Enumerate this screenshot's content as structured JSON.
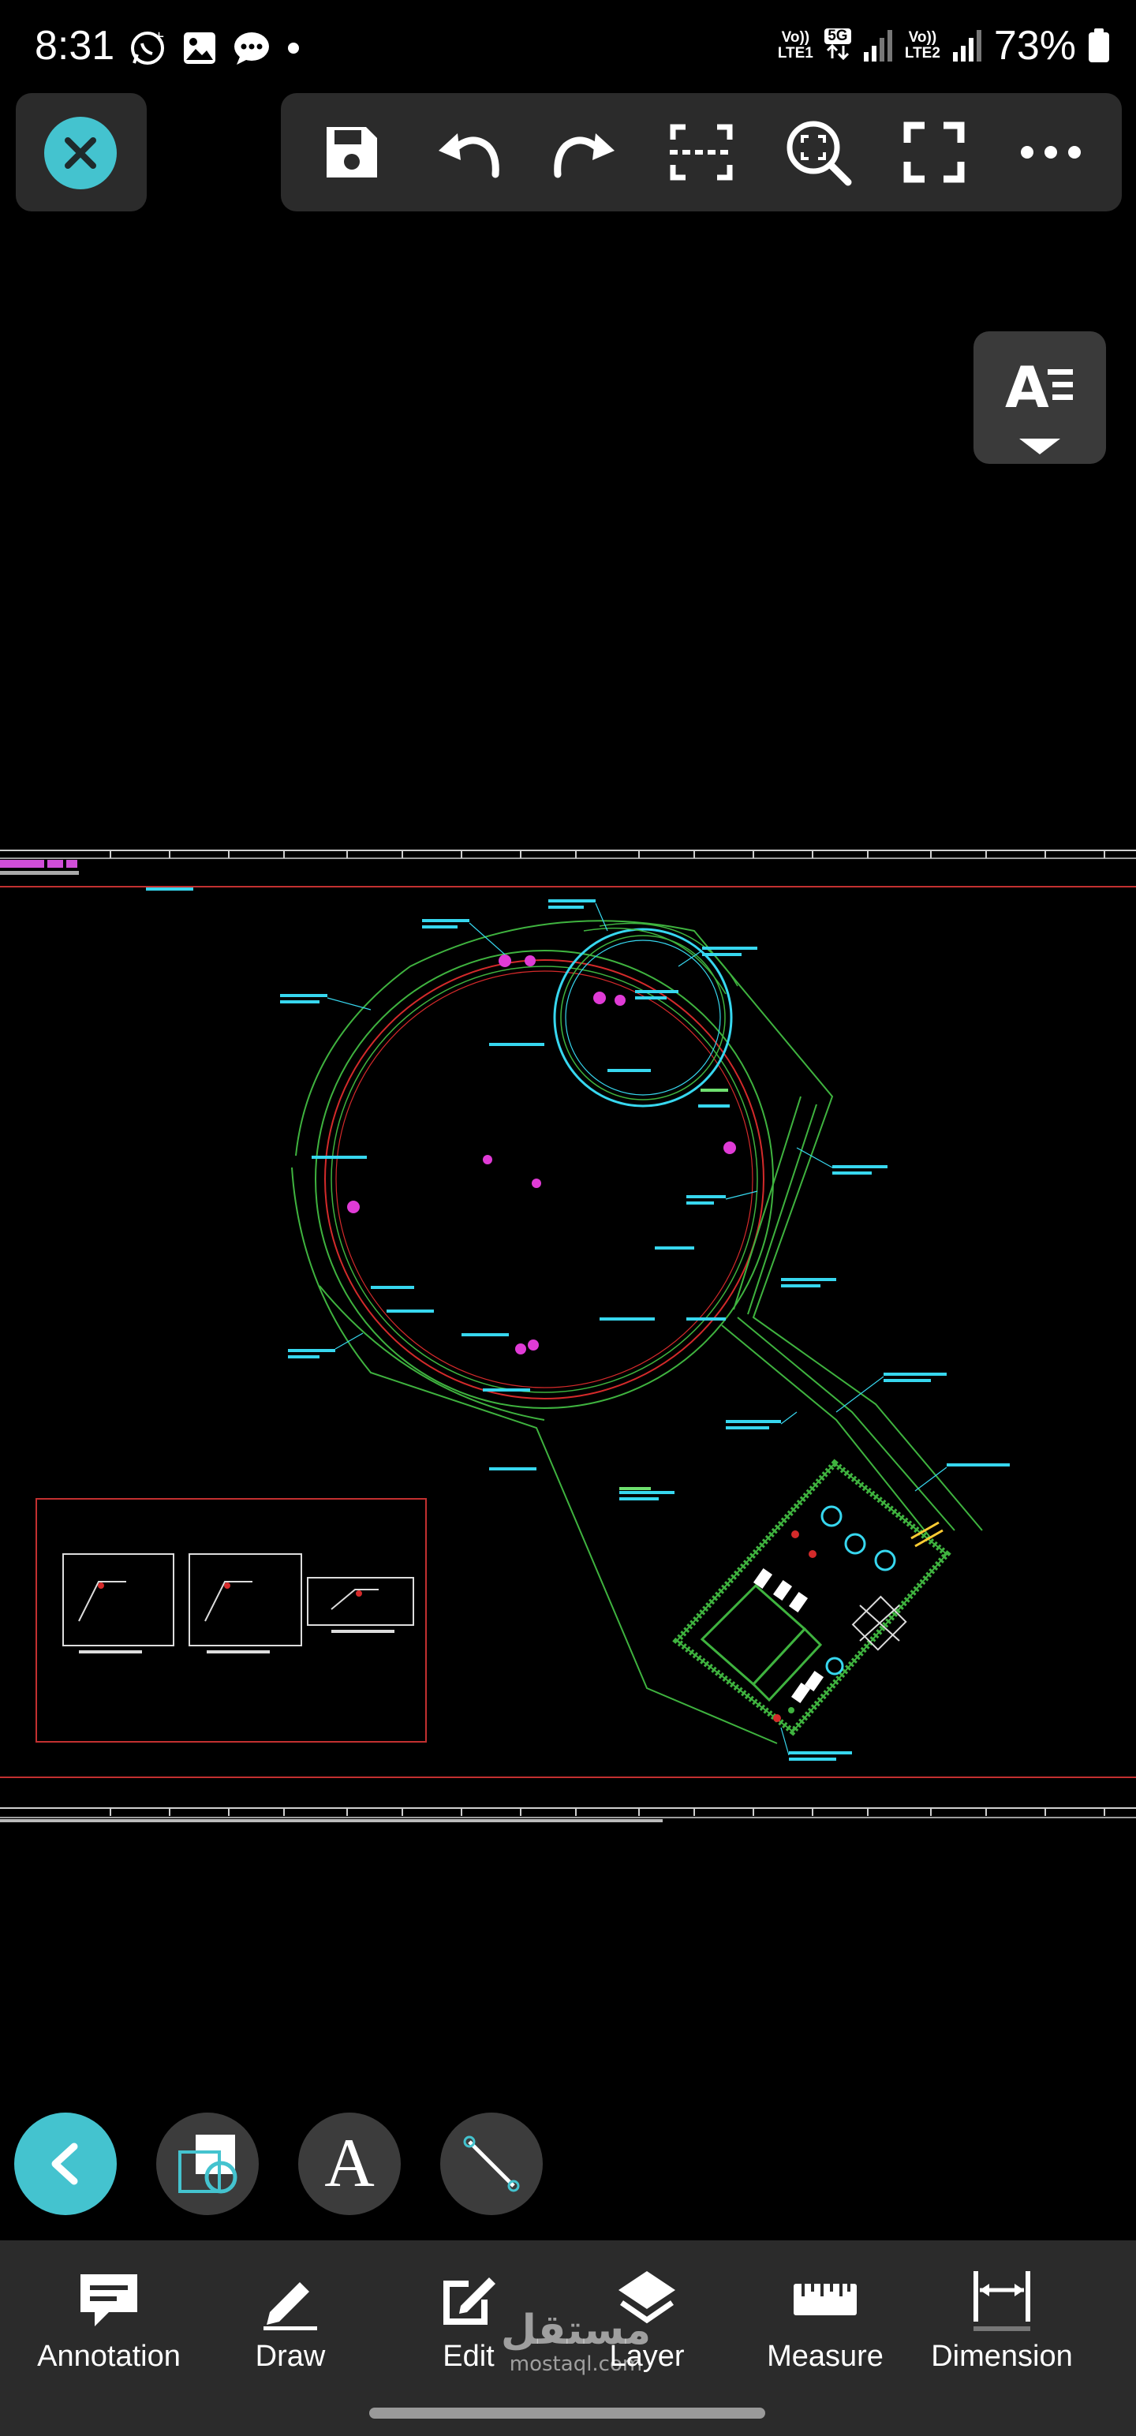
{
  "status_bar": {
    "time": "8:31",
    "sim1_top": "Vo))",
    "sim1_bottom": "LTE1",
    "network": "5G",
    "sim2_top": "Vo))",
    "sim2_bottom": "LTE2",
    "battery": "73%"
  },
  "toolbar": {
    "items": [
      "save-icon",
      "undo-icon",
      "redo-icon",
      "scan-icon",
      "zoom-fit-icon",
      "fullscreen-icon",
      "more-icon"
    ]
  },
  "bottom_nav": {
    "items": [
      {
        "label": "Annotation",
        "icon": "annotation-icon"
      },
      {
        "label": "Draw",
        "icon": "pencil-icon"
      },
      {
        "label": "Edit",
        "icon": "edit-icon"
      },
      {
        "label": "Layer",
        "icon": "layers-icon"
      },
      {
        "label": "Measure",
        "icon": "ruler-icon"
      },
      {
        "label": "Dimension",
        "icon": "dimension-icon"
      }
    ]
  },
  "quick_tools": {
    "text_glyph": "A"
  },
  "watermark": {
    "arabic": "مستقل",
    "latin": "mostaql.com"
  },
  "colors": {
    "accent": "#44c3cf",
    "panel": "#2b2b2b",
    "cad_green": "#3fb33f",
    "cad_red": "#d42a2a",
    "cad_cyan": "#37d7ef",
    "cad_magenta": "#e03bd6"
  }
}
